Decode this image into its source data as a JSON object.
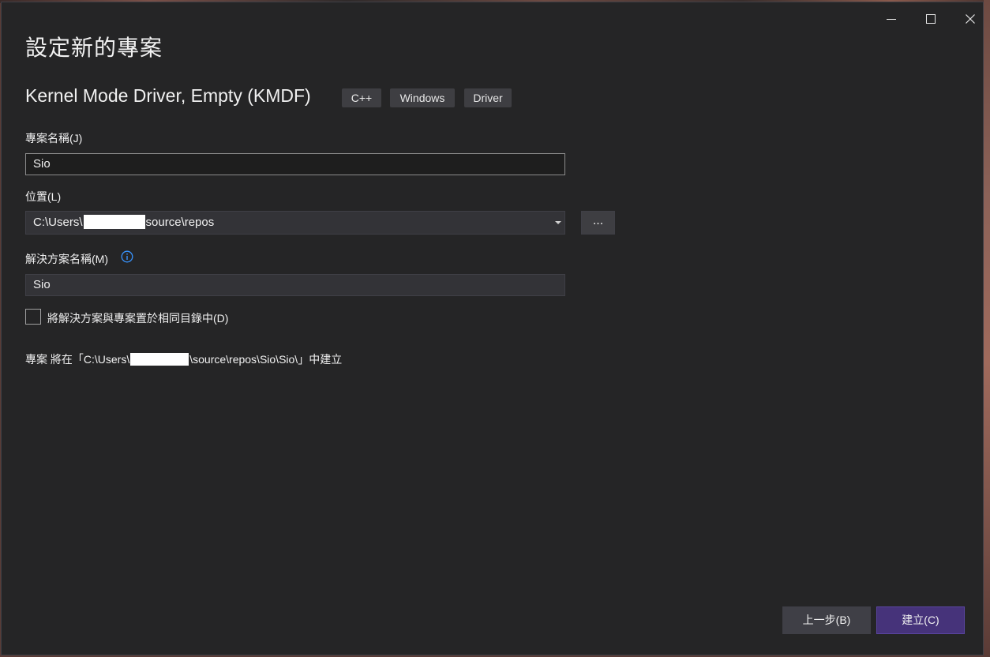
{
  "window": {
    "title": "設定新的專案",
    "controls": {
      "minimize_icon": "minimize-icon",
      "maximize_icon": "maximize-icon",
      "close_icon": "close-icon"
    }
  },
  "template": {
    "name": "Kernel Mode Driver, Empty (KMDF)",
    "tags": [
      "C++",
      "Windows",
      "Driver"
    ]
  },
  "form": {
    "project_name_label": "專案名稱(J)",
    "project_name_value": "Sio",
    "location_label": "位置(L)",
    "location_prefix": "C:\\Users\\",
    "location_suffix": "source\\repos",
    "browse_label": "...",
    "solution_name_label": "解決方案名稱(M)",
    "solution_name_value": "Sio",
    "same_dir_label": "將解決方案與專案置於相同目錄中(D)",
    "same_dir_checked": false
  },
  "info": {
    "prefix": "專案 將在「C:\\Users\\",
    "suffix": "\\source\\repos\\Sio\\Sio\\」中建立"
  },
  "buttons": {
    "back": "上一步(B)",
    "create": "建立(C)"
  },
  "colors": {
    "window_bg": "#252526",
    "accent": "#46337a",
    "info_icon": "#3794ff"
  }
}
